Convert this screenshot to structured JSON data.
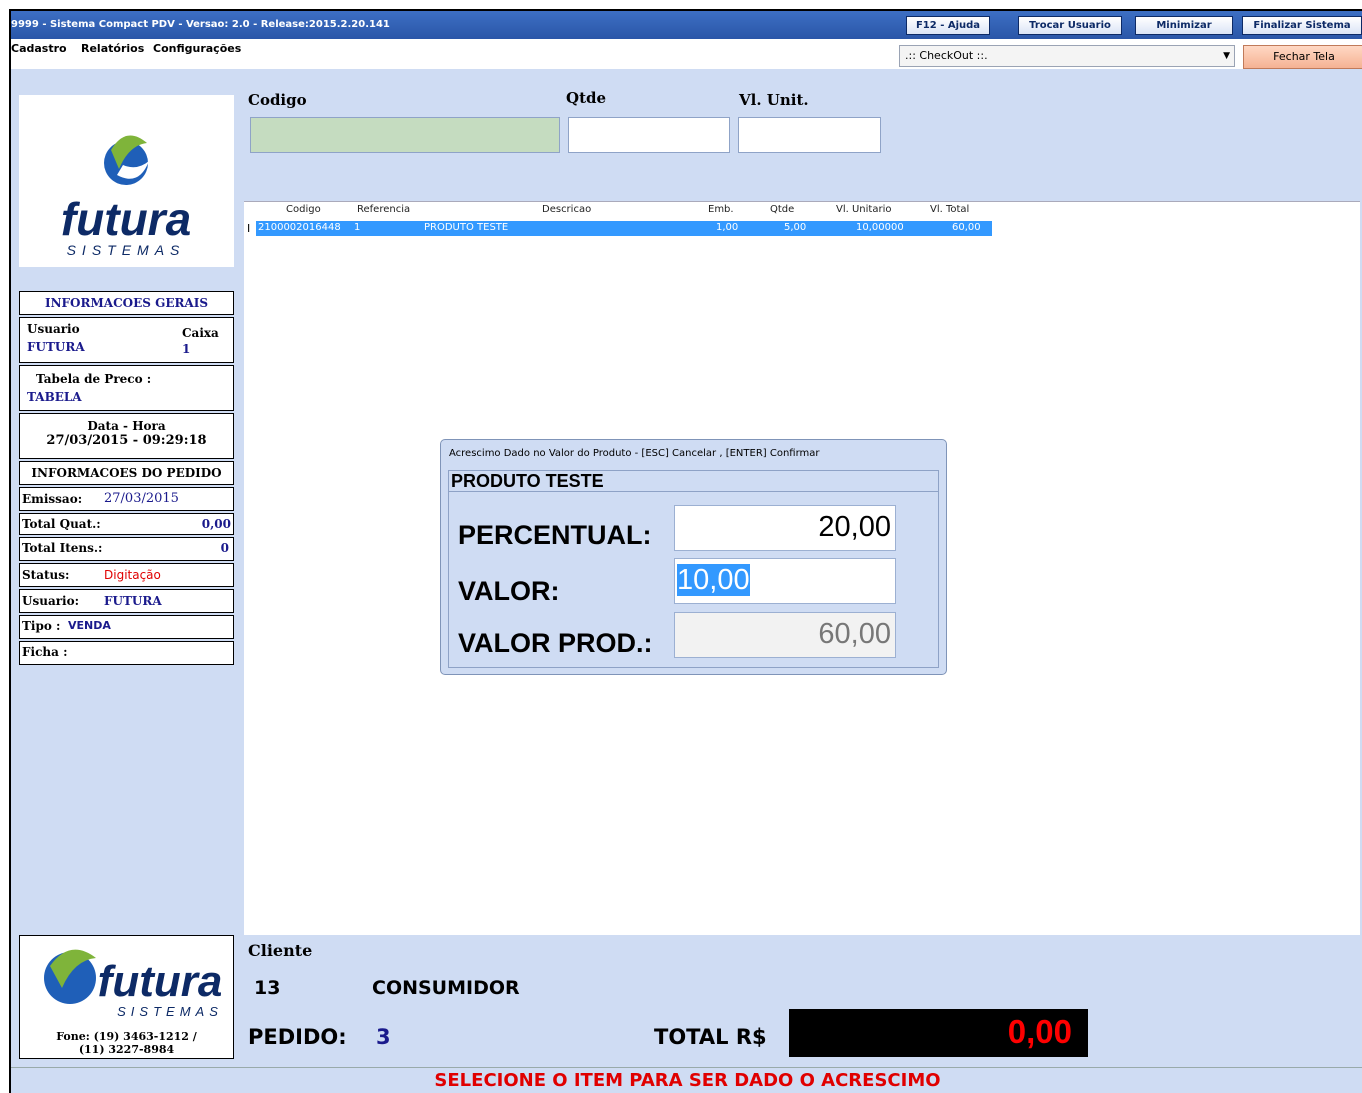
{
  "titlebar": {
    "title": "9999 - Sistema Compact PDV - Versao: 2.0 - Release:2015.2.20.141",
    "buttons": [
      "F12 - Ajuda",
      "Trocar Usuario",
      "Minimizar",
      "Finalizar Sistema"
    ]
  },
  "menu": {
    "items": [
      "Cadastro",
      "Relatórios",
      "Configurações"
    ]
  },
  "toolbar": {
    "screen_select": ".:: CheckOut ::.",
    "close_label": "Fechar Tela"
  },
  "logo": {
    "brand": "futura",
    "sub": "SISTEMAS"
  },
  "info": {
    "header": "INFORMACOES GERAIS",
    "usuario_label": "Usuario",
    "usuario_value": "FUTURA",
    "caixa_label": "Caixa",
    "caixa_value": "1",
    "tabela_label": "Tabela de Preco :",
    "tabela_value": "TABELA",
    "datahora_label": "Data - Hora",
    "datahora_value": "27/03/2015 - 09:29:18",
    "pedido_header": "INFORMACOES DO PEDIDO",
    "emissao_label": "Emissao:",
    "emissao_value": "27/03/2015",
    "totalquat_label": "Total Quat.:",
    "totalquat_value": "0,00",
    "totalitens_label": "Total Itens.:",
    "totalitens_value": "0",
    "status_label": "Status:",
    "status_value": "Digitação",
    "usuario2_label": "Usuario:",
    "usuario2_value": "FUTURA",
    "tipo_label": "Tipo :",
    "tipo_value": "VENDA",
    "ficha_label": "Ficha :"
  },
  "entry": {
    "codigo_label": "Codigo",
    "qtde_label": "Qtde",
    "vlunit_label": "Vl. Unit."
  },
  "grid": {
    "columns": [
      "Codigo",
      "Referencia",
      "Descricao",
      "Emb.",
      "Qtde",
      "Vl. Unitario",
      "Vl. Total"
    ],
    "rows": [
      {
        "codigo": "2100002016448",
        "referencia": "1",
        "descricao": "PRODUTO TESTE",
        "emb": "1,00",
        "qtde": "5,00",
        "vlunitario": "10,00000",
        "vltotal": "60,00"
      }
    ]
  },
  "dialog": {
    "title": "Acrescimo Dado no Valor do Produto - [ESC] Cancelar , [ENTER] Confirmar",
    "product": "PRODUTO TESTE",
    "percentual_label": "PERCENTUAL:",
    "percentual_value": "20,00",
    "valor_label": "VALOR:",
    "valor_value": "10,00",
    "valorprod_label": "VALOR PROD.:",
    "valorprod_value": "60,00"
  },
  "footer": {
    "phone_line1": "Fone: (19) 3463-1212 /",
    "phone_line2": "(11) 3227-8984",
    "cliente_label": "Cliente",
    "cliente_code": "13",
    "cliente_name": "CONSUMIDOR",
    "pedido_label": "PEDIDO:",
    "pedido_value": "3",
    "total_label": "TOTAL R$",
    "total_value": "0,00",
    "status_message": "SELECIONE O ITEM PARA SER DADO O ACRESCIMO"
  },
  "colors": {
    "highlight": "#3399ff",
    "status_red": "#e00000",
    "navy": "#1a1a8c",
    "panel": "#cfdcf3"
  }
}
